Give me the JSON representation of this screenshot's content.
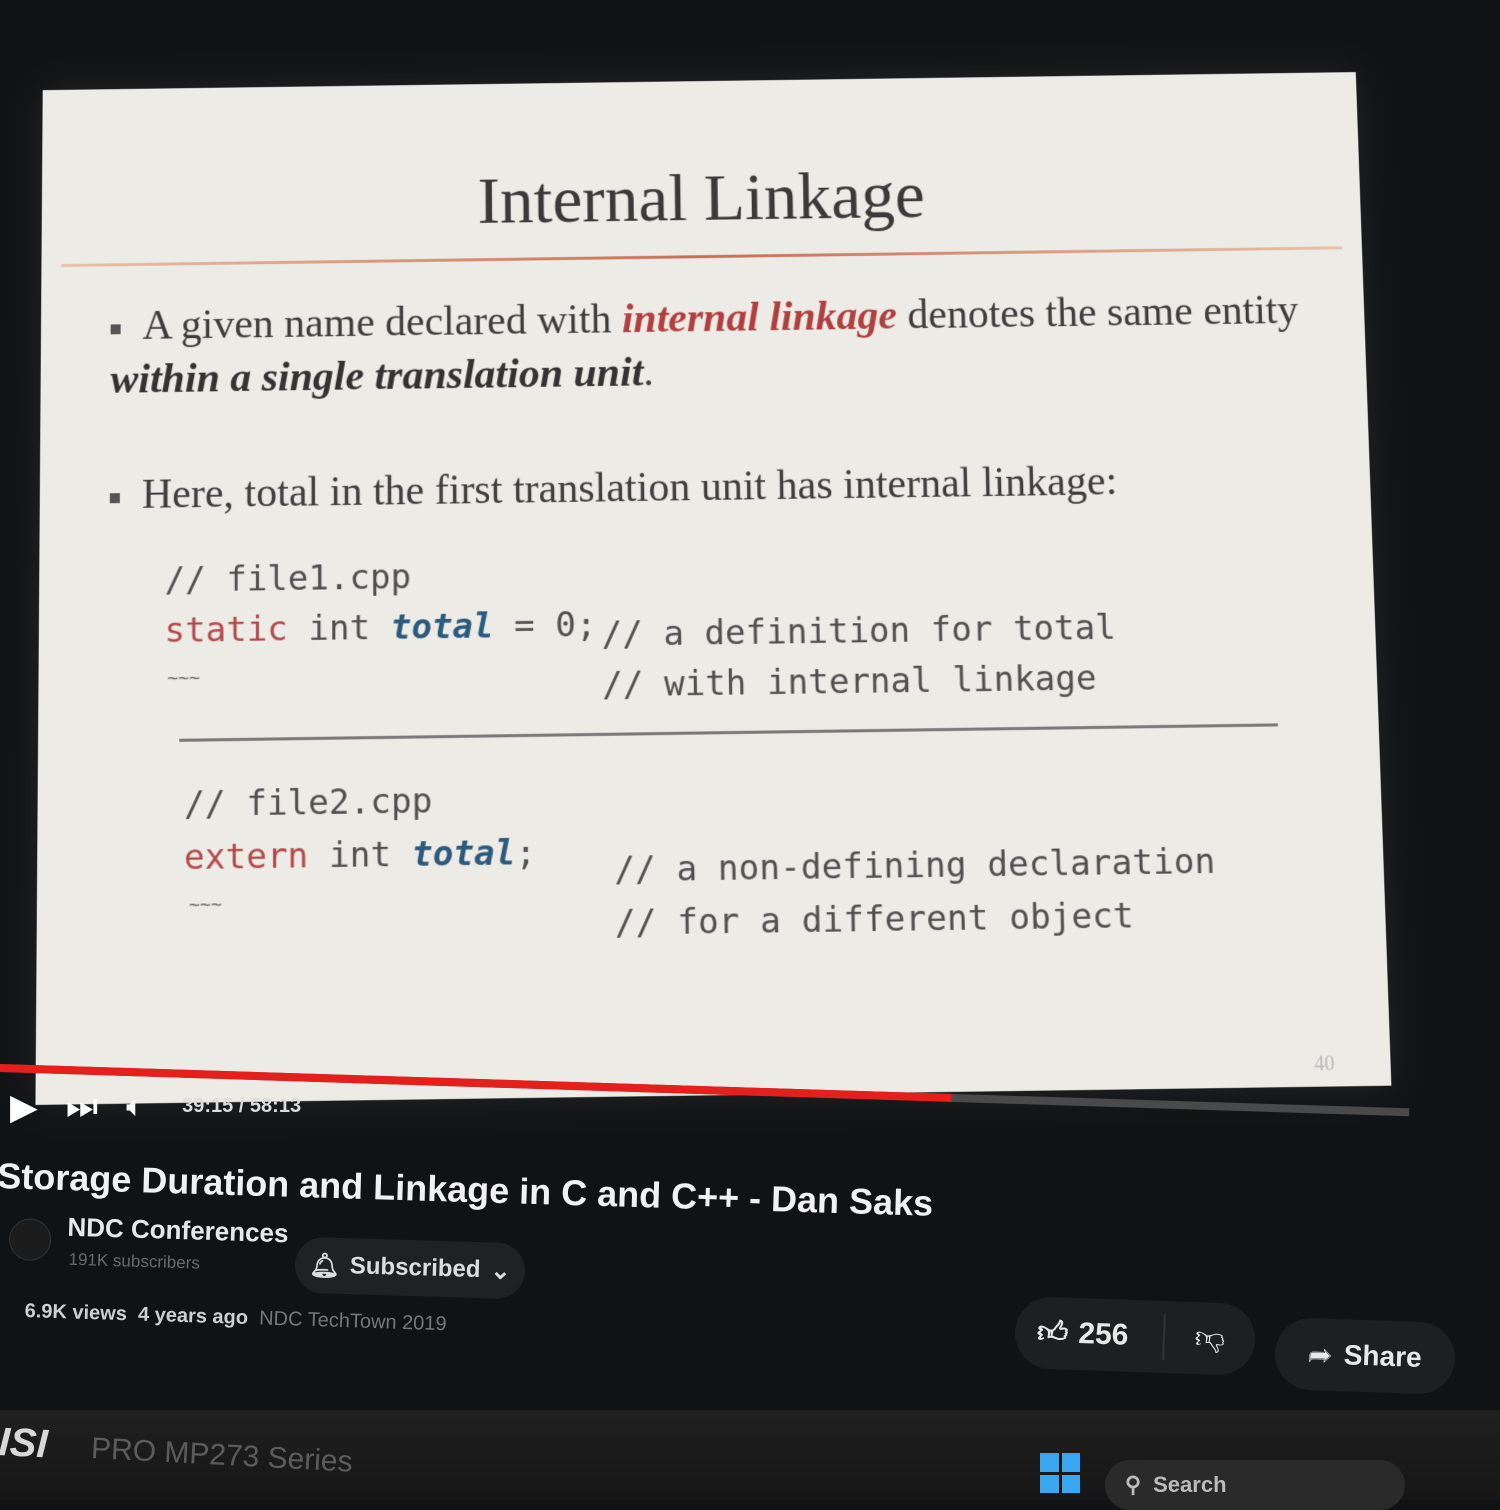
{
  "slide": {
    "title": "Internal Linkage",
    "bullet1": {
      "pre": "A given name declared with ",
      "highlight": "internal linkage",
      "mid": " denotes the same entity ",
      "bold": "within a single translation unit",
      "post": "."
    },
    "bullet2": "Here, total in the first translation unit has internal linkage:",
    "file1": {
      "comment": "// file1.cpp",
      "kw": "static",
      "type": " int ",
      "ident": "total",
      "rest": " = 0;",
      "tilde": "~~~",
      "note1": "// a definition for total",
      "note2": "// with internal linkage"
    },
    "file2": {
      "comment": "// file2.cpp",
      "kw": "extern",
      "type": " int ",
      "ident": "total",
      "rest": ";",
      "tilde": "~~~",
      "note1": "// a non-defining declaration",
      "note2": "// for a different object"
    },
    "page_number": "40"
  },
  "player": {
    "time": "39:15 / 58:13",
    "progress": 0.675
  },
  "video": {
    "title": "Storage Duration and Linkage in C and C++ - Dan Saks",
    "channel": "NDC Conferences",
    "subscribers": "191K subscribers",
    "subscribed_label": "Subscribed",
    "views": "6.9K views",
    "age": "4 years ago",
    "event": "NDC TechTown 2019",
    "likes": "256",
    "share_label": "Share"
  },
  "monitor": {
    "brand": "ISI",
    "model": "PRO MP273 Series"
  },
  "taskbar": {
    "search_label": "Search"
  },
  "colors": {
    "accent_red": "#e5201c",
    "code_keyword": "#b34a4a",
    "code_ident": "#2c5a7e"
  }
}
